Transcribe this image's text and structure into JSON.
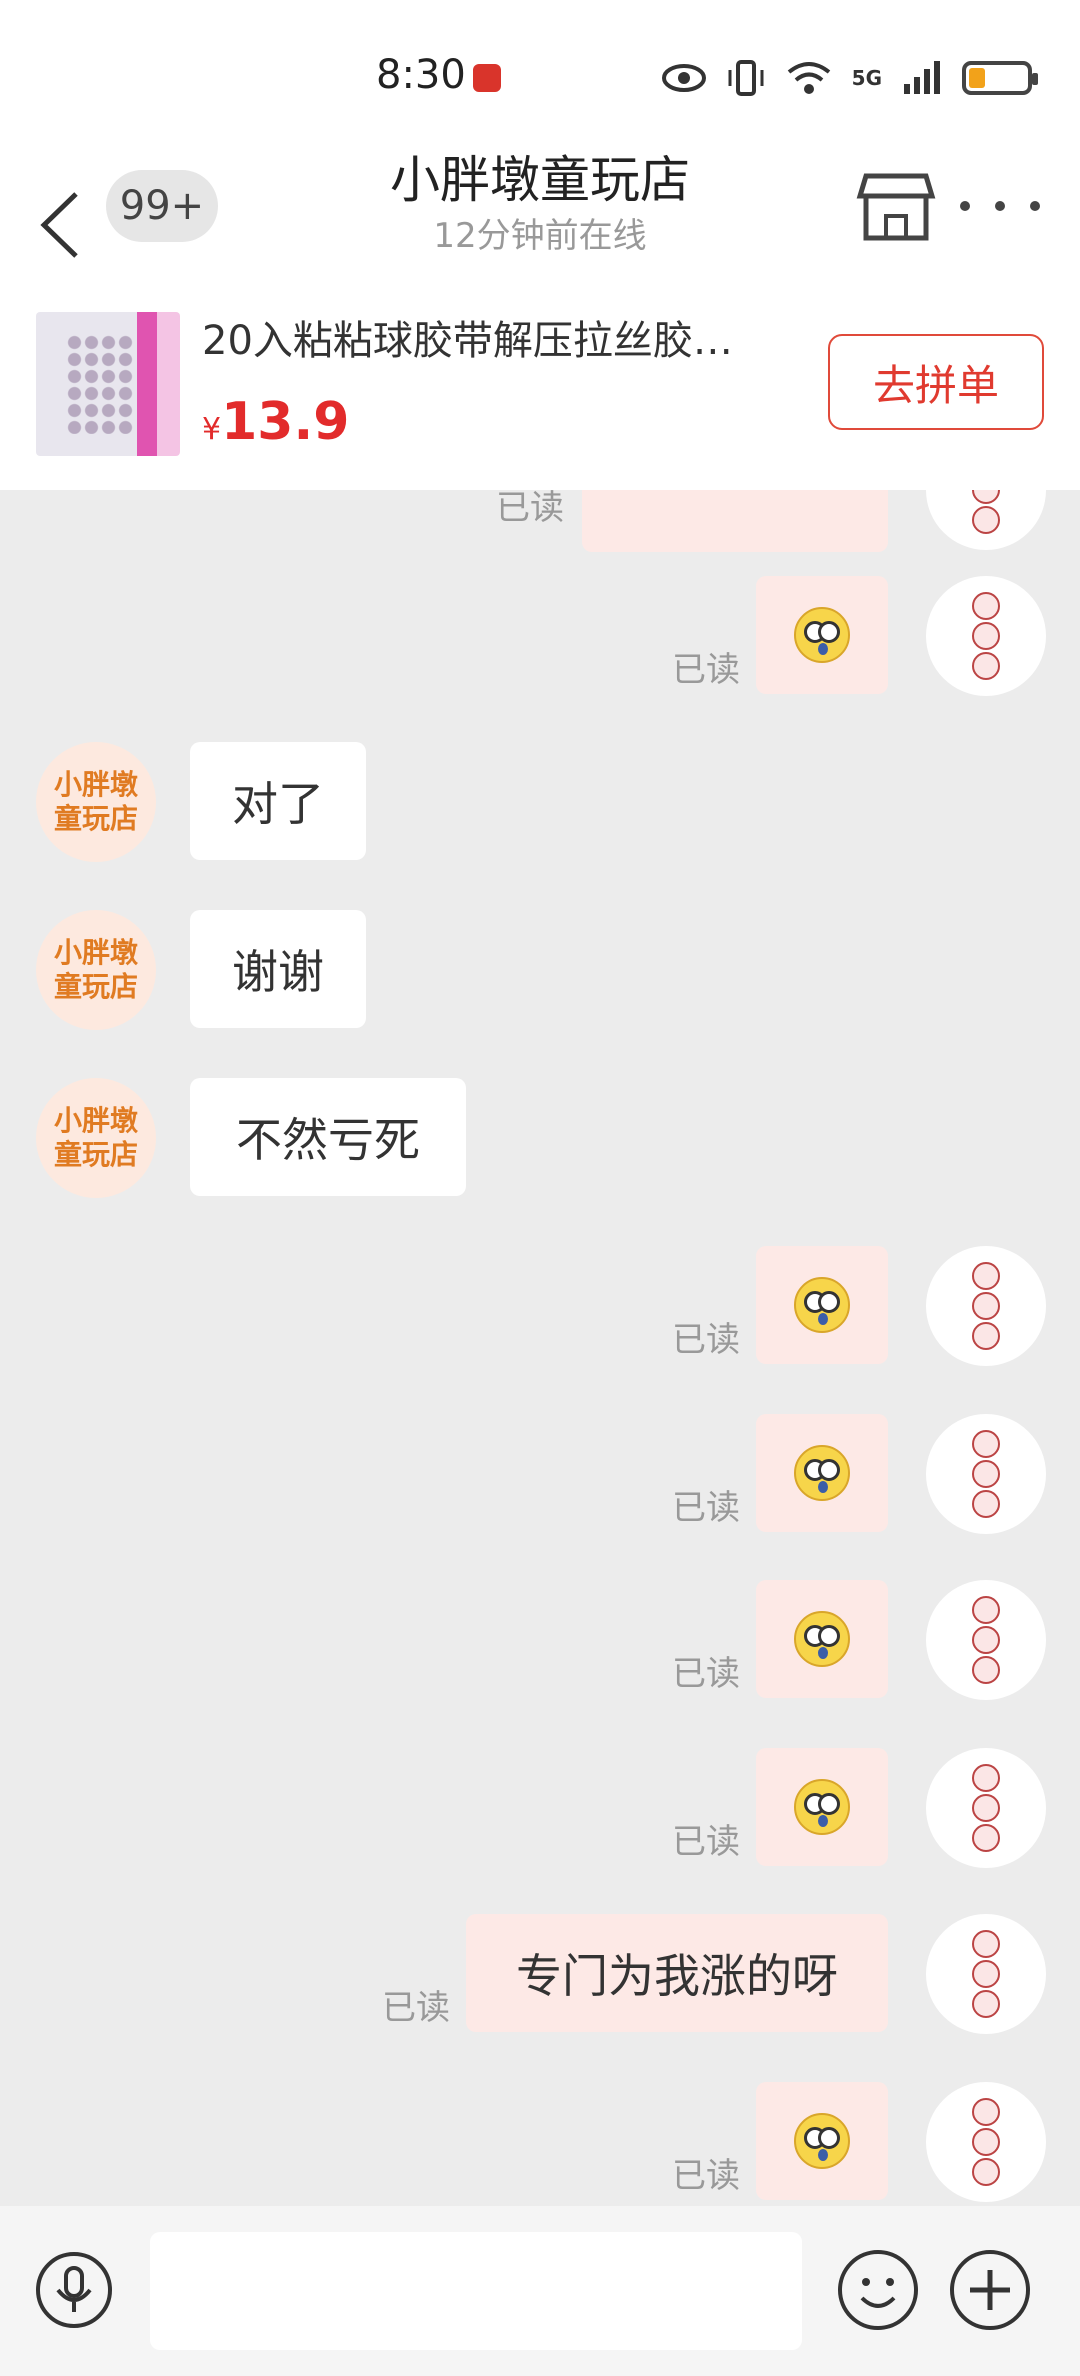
{
  "status_bar": {
    "time": "8:30",
    "network": "5G",
    "icons": [
      "notification-icon",
      "eye-icon",
      "vibrate-icon",
      "wifi-icon",
      "signal-icon",
      "battery-icon"
    ]
  },
  "header": {
    "back_icon": "chevron-left-icon",
    "unread_badge": "99+",
    "shop_name": "小胖墩童玩店",
    "online_status": "12分钟前在线",
    "store_icon": "store-icon",
    "more_icon": "more-icon"
  },
  "product": {
    "title": "20入粘粘球胶带解压拉丝胶…",
    "currency": "¥",
    "price": "13.9",
    "action_label": "去拼单"
  },
  "shop_avatar_text": [
    "小胖墩",
    "童玩店"
  ],
  "messages": [
    {
      "side": "out",
      "kind": "emoji",
      "read": "已读",
      "partial": true
    },
    {
      "side": "out",
      "kind": "emoji",
      "read": "已读"
    },
    {
      "side": "in",
      "kind": "text",
      "text": "对了"
    },
    {
      "side": "in",
      "kind": "text",
      "text": "谢谢"
    },
    {
      "side": "in",
      "kind": "text",
      "text": "不然亏死"
    },
    {
      "side": "out",
      "kind": "emoji",
      "read": "已读"
    },
    {
      "side": "out",
      "kind": "emoji",
      "read": "已读"
    },
    {
      "side": "out",
      "kind": "emoji",
      "read": "已读"
    },
    {
      "side": "out",
      "kind": "emoji",
      "read": "已读"
    },
    {
      "side": "out",
      "kind": "text",
      "text": "专门为我涨的呀",
      "read": "已读"
    },
    {
      "side": "out",
      "kind": "emoji",
      "read": "已读"
    }
  ],
  "input_bar": {
    "mic_icon": "microphone-icon",
    "input_value": "",
    "emoji_icon": "smiley-icon",
    "plus_icon": "plus-icon"
  },
  "colors": {
    "accent": "#e03a2f",
    "chat_bg": "#ececec",
    "outgoing_bubble": "#fde9e6",
    "incoming_bubble": "#ffffff"
  }
}
